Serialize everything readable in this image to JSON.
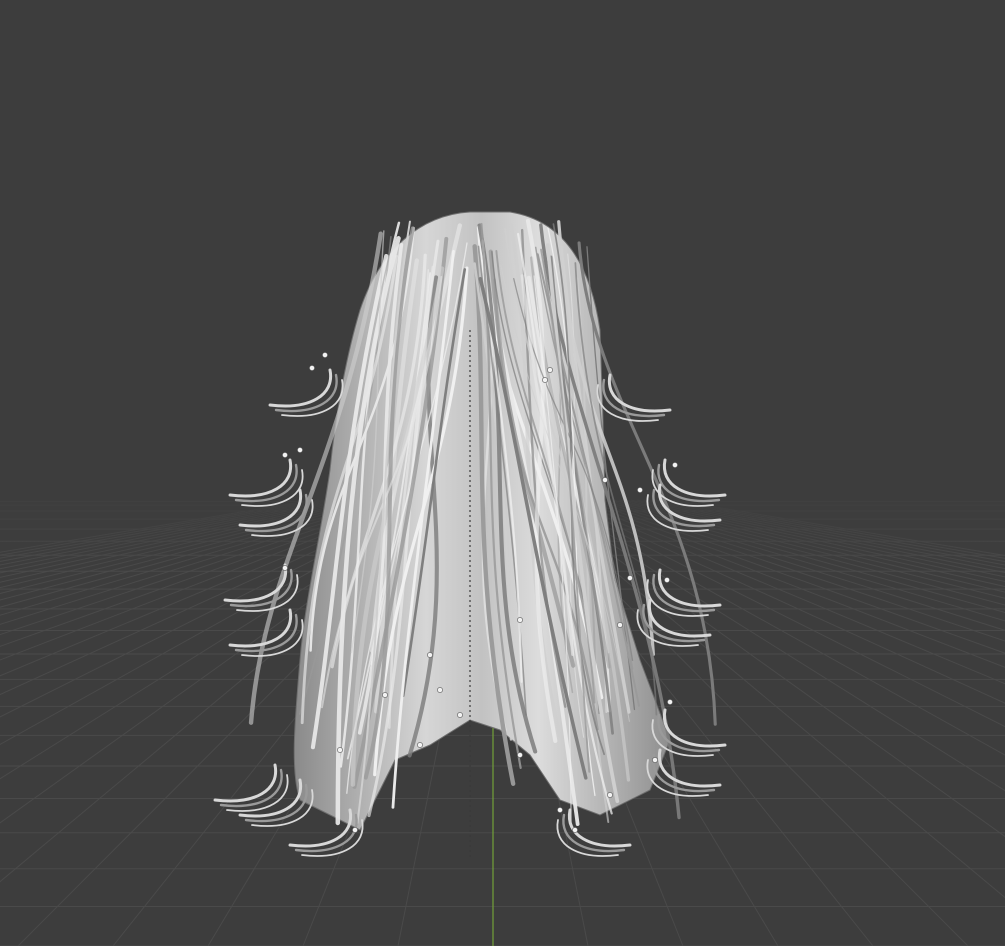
{
  "viewport": {
    "view": "3d-viewport",
    "background_color": "#3d3d3d",
    "grid_color": "#4a4a4a",
    "y_axis_color": "#6f9a3a",
    "object": {
      "name_hint": "hair-mesh",
      "shading": "solid",
      "base_color": "#bdbdbd",
      "highlight_color": "#e2e2e2",
      "shadow_color": "#7a7a7a"
    }
  }
}
